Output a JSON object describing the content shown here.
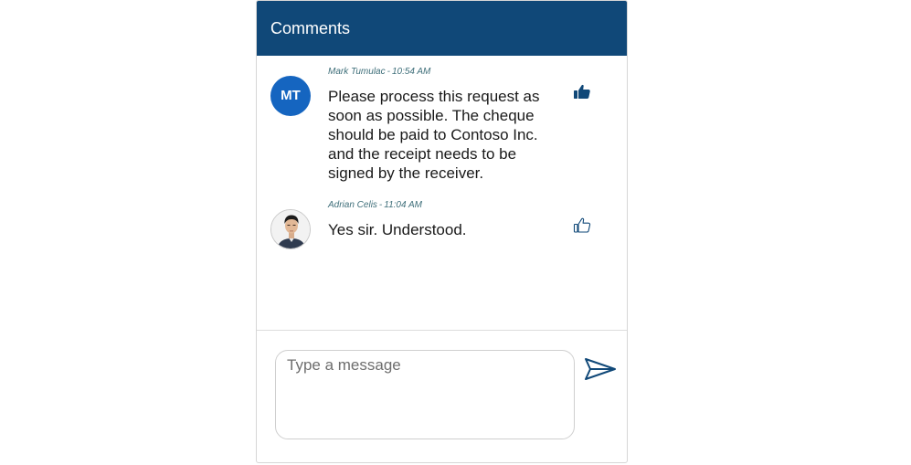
{
  "header": {
    "title": "Comments"
  },
  "comments": [
    {
      "author": "Mark Tumulac",
      "time": "10:54 AM",
      "initials": "MT",
      "text": "Please process this request as soon as possible. The cheque should be paid to Contoso Inc. and the receipt needs to be signed by the receiver.",
      "liked": true,
      "avatar_color": "#1565c0"
    },
    {
      "author": "Adrian Celis",
      "time": "11:04 AM",
      "avatar": "profile-photo",
      "text": "Yes sir. Understood.",
      "liked": false
    }
  ],
  "meta_separator": "-",
  "composer": {
    "placeholder": "Type a message",
    "value": ""
  },
  "icons": {
    "like_filled": "thumbs-up-filled-icon",
    "like_outline": "thumbs-up-outline-icon",
    "send": "send-icon"
  },
  "colors": {
    "header": "#104878",
    "accent": "#104878",
    "avatar": "#1565c0"
  }
}
